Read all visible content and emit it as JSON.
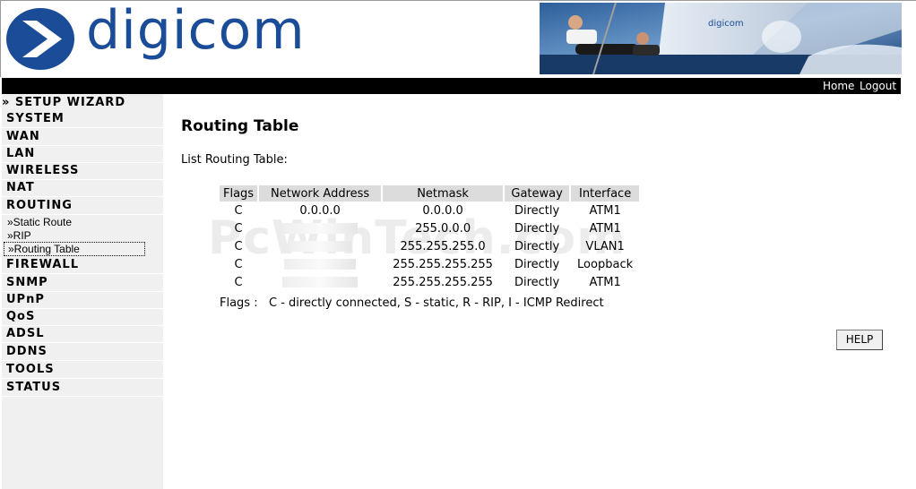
{
  "brand": {
    "name": "digicom",
    "color": "#1b4c98"
  },
  "topbar": {
    "home": "Home",
    "logout": "Logout"
  },
  "sidebar": {
    "wizard": "» SETUP WIZARD",
    "items": [
      "SYSTEM",
      "WAN",
      "LAN",
      "WIRELESS",
      "NAT",
      "ROUTING",
      "FIREWALL",
      "SNMP",
      "UPnP",
      "QoS",
      "ADSL",
      "DDNS",
      "TOOLS",
      "STATUS"
    ],
    "routing_sub": [
      "»Static Route",
      "»RIP",
      "»Routing Table"
    ],
    "active_sub": "»Routing Table"
  },
  "main": {
    "title": "Routing Table",
    "subtitle": "List Routing Table:",
    "table": {
      "headers": [
        "Flags",
        "Network Address",
        "Netmask",
        "Gateway",
        "Interface"
      ],
      "rows": [
        [
          "C",
          "0.0.0.0",
          "0.0.0.0",
          "Directly",
          "ATM1"
        ],
        [
          "C",
          "",
          "255.0.0.0",
          "Directly",
          "ATM1"
        ],
        [
          "C",
          "",
          "255.255.255.0",
          "Directly",
          "VLAN1"
        ],
        [
          "C",
          "",
          "255.255.255.255",
          "Directly",
          "Loopback"
        ],
        [
          "C",
          "",
          "255.255.255.255",
          "Directly",
          "ATM1"
        ]
      ]
    },
    "flags_note": "Flags :   C - directly connected, S - static, R - RIP, I - ICMP Redirect",
    "help_button": "HELP"
  },
  "watermark": "PcWinTech.com"
}
